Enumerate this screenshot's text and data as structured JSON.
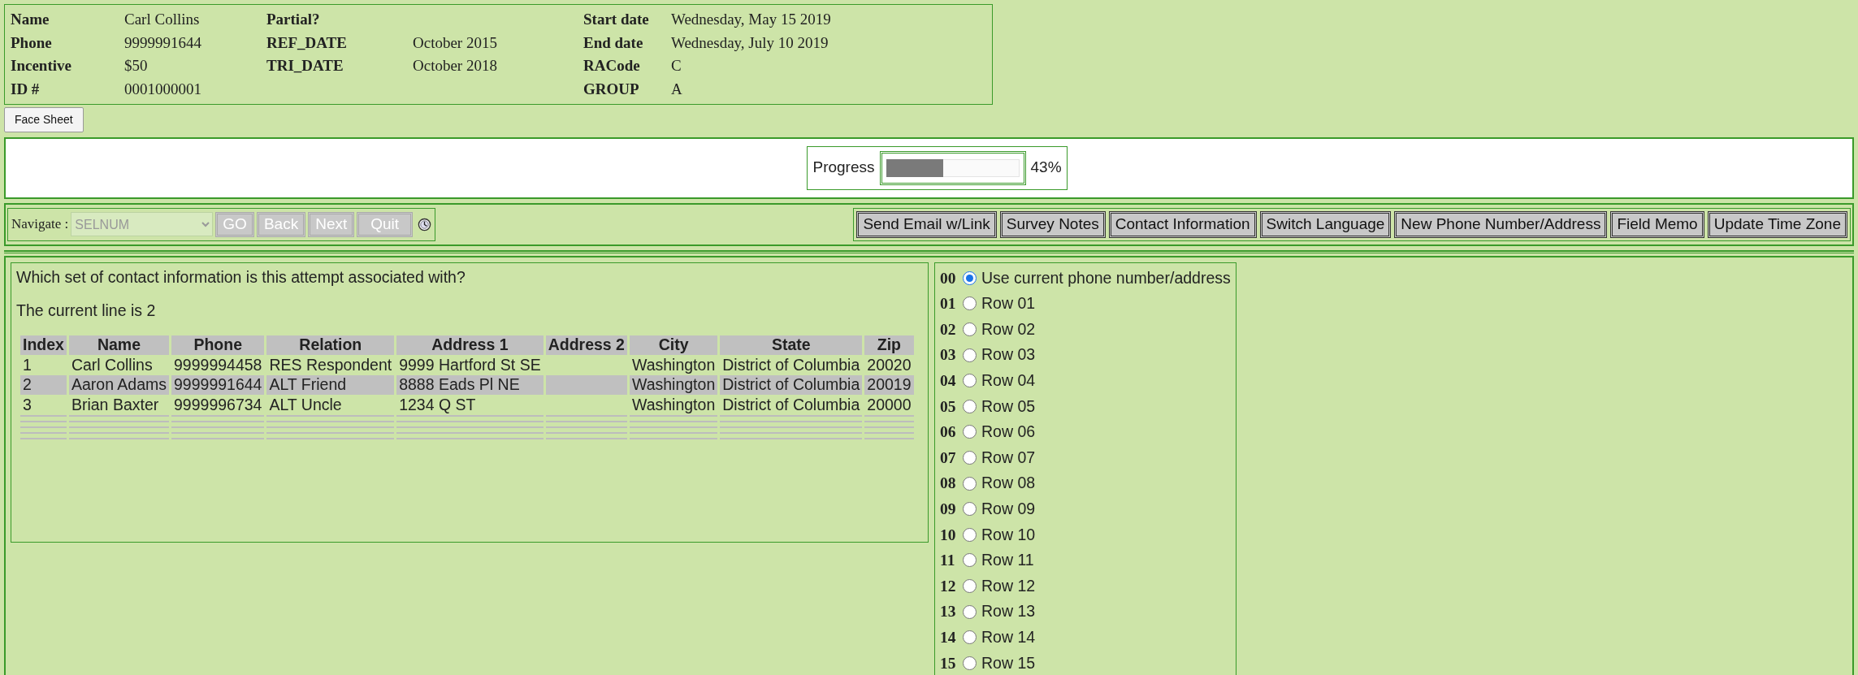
{
  "record": {
    "columns": [
      [
        {
          "label": "Name",
          "value": "Carl Collins"
        },
        {
          "label": "Phone",
          "value": "9999991644"
        },
        {
          "label": "Incentive",
          "value": "$50"
        },
        {
          "label": "ID #",
          "value": "0001000001"
        }
      ],
      [
        {
          "label": "Partial?"
        },
        {
          "label": "REF_DATE",
          "value": "October 2015"
        },
        {
          "label": "TRI_DATE",
          "value": "October 2018"
        }
      ],
      [
        {
          "label": "Start date",
          "value": "Wednesday, May 15 2019"
        },
        {
          "label": "End date",
          "value": "Wednesday, July 10 2019"
        },
        {
          "label": "RACode",
          "value": "C"
        },
        {
          "label": "GROUP",
          "value": "A"
        }
      ]
    ]
  },
  "face_sheet_button": "Face Sheet",
  "progress": {
    "label": "Progress",
    "level": 0.43,
    "reading": "43%"
  },
  "navigate": {
    "label": "Navigate :",
    "select": {
      "value": "SELNUM",
      "disabled": true
    },
    "buttons": [
      {
        "label": "GO",
        "disabled": true
      },
      {
        "label": "Back",
        "disabled": true
      },
      {
        "label": "Next",
        "disabled": true
      },
      {
        "label": "Quit",
        "disabled": true
      }
    ]
  },
  "actions": [
    "Send Email w/Link",
    "Survey Notes",
    "Contact Information",
    "Switch Language",
    "New Phone Number/Address",
    "Field Memo",
    "Update Time Zone"
  ],
  "question": "Which set of contact information is this attempt associated with?",
  "current_line": "The current line is 2",
  "table": {
    "columns": [
      "Index",
      "Name",
      "Phone",
      "Relation",
      "Address 1",
      "Address 2",
      "City",
      "State",
      "Zip"
    ],
    "rows": [
      {
        "selected": false,
        "cells": [
          "1",
          "Carl Collins",
          "9999994458",
          "RES Respondent",
          "9999 Hartford St SE",
          "",
          "Washington",
          "District of Columbia",
          "20020"
        ]
      },
      {
        "selected": true,
        "cells": [
          "2",
          "Aaron Adams",
          "9999991644",
          "ALT Friend",
          "8888 Eads Pl NE",
          "",
          "Washington",
          "District of Columbia",
          "20019"
        ]
      },
      {
        "selected": false,
        "cells": [
          "3",
          "Brian Baxter",
          "9999996734",
          "ALT Uncle",
          "1234 Q ST",
          "",
          "Washington",
          "District of Columbia",
          "20000"
        ]
      }
    ]
  },
  "options": [
    {
      "code": "00",
      "label": "Use current phone number/address",
      "selected": true
    },
    {
      "code": "01",
      "label": "Row 01",
      "selected": false
    },
    {
      "code": "02",
      "label": "Row 02",
      "selected": false
    },
    {
      "code": "03",
      "label": "Row 03",
      "selected": false
    },
    {
      "code": "04",
      "label": "Row 04",
      "selected": false
    },
    {
      "code": "05",
      "label": "Row 05",
      "selected": false
    },
    {
      "code": "06",
      "label": "Row 06",
      "selected": false
    },
    {
      "code": "07",
      "label": "Row 07",
      "selected": false
    },
    {
      "code": "08",
      "label": "Row 08",
      "selected": false
    },
    {
      "code": "09",
      "label": "Row 09",
      "selected": false
    },
    {
      "code": "10",
      "label": "Row 10",
      "selected": false
    },
    {
      "code": "11",
      "label": "Row 11",
      "selected": false
    },
    {
      "code": "12",
      "label": "Row 12",
      "selected": false
    },
    {
      "code": "13",
      "label": "Row 13",
      "selected": false
    },
    {
      "code": "14",
      "label": "Row 14",
      "selected": false
    },
    {
      "code": "15",
      "label": "Row 15",
      "selected": false
    }
  ]
}
